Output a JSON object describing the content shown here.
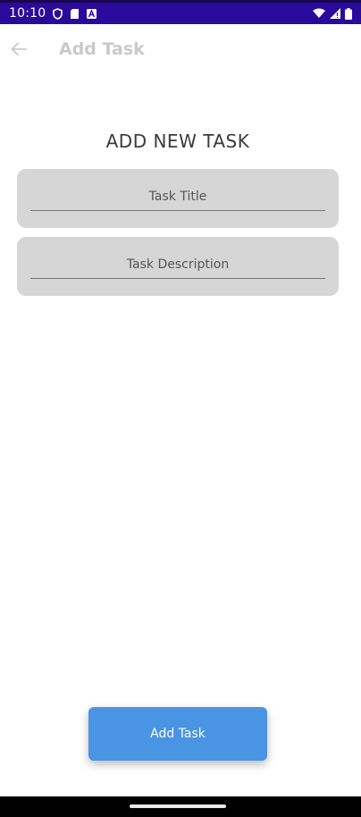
{
  "status_bar": {
    "time": "10:10",
    "icons_left": [
      "shield-icon",
      "sd-card-icon",
      "a-badge-icon"
    ],
    "icons_right": [
      "wifi-icon",
      "signal-icon",
      "battery-icon"
    ],
    "background_color": "#2a0a9a"
  },
  "app_bar": {
    "title": "Add Task",
    "back_icon": "arrow-back-icon"
  },
  "form": {
    "heading": "ADD NEW TASK",
    "title_field": {
      "placeholder": "Task Title",
      "value": ""
    },
    "description_field": {
      "placeholder": "Task Description",
      "value": ""
    }
  },
  "actions": {
    "add_label": "Add Task",
    "add_color": "#4a94e4"
  }
}
